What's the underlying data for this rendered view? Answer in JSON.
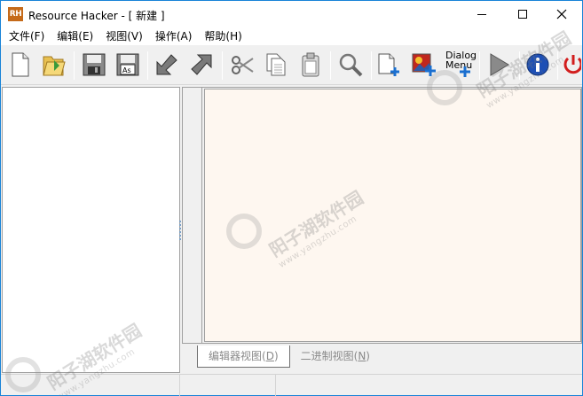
{
  "window": {
    "app_icon_text": "RH",
    "title": "Resource Hacker - [ 新建 ]"
  },
  "menu": [
    "文件(F)",
    "编辑(E)",
    "视图(V)",
    "操作(A)",
    "帮助(H)"
  ],
  "toolbar": {
    "dialog_menu_label_1": "Dialog",
    "dialog_menu_label_2": "Menu"
  },
  "tabs": {
    "editor_view_prefix": "编辑器视图(",
    "editor_view_key": "D",
    "editor_view_suffix": ")",
    "binary_view_prefix": "二进制视图(",
    "binary_view_key": "N",
    "binary_view_suffix": ")"
  },
  "watermark": {
    "cn": "阳子湖软件园",
    "url": "www.yangzhu.com"
  },
  "colors": {
    "title_border": "#1883d7",
    "editor_bg": "#fef7f0",
    "app_icon": "#c56a19"
  }
}
